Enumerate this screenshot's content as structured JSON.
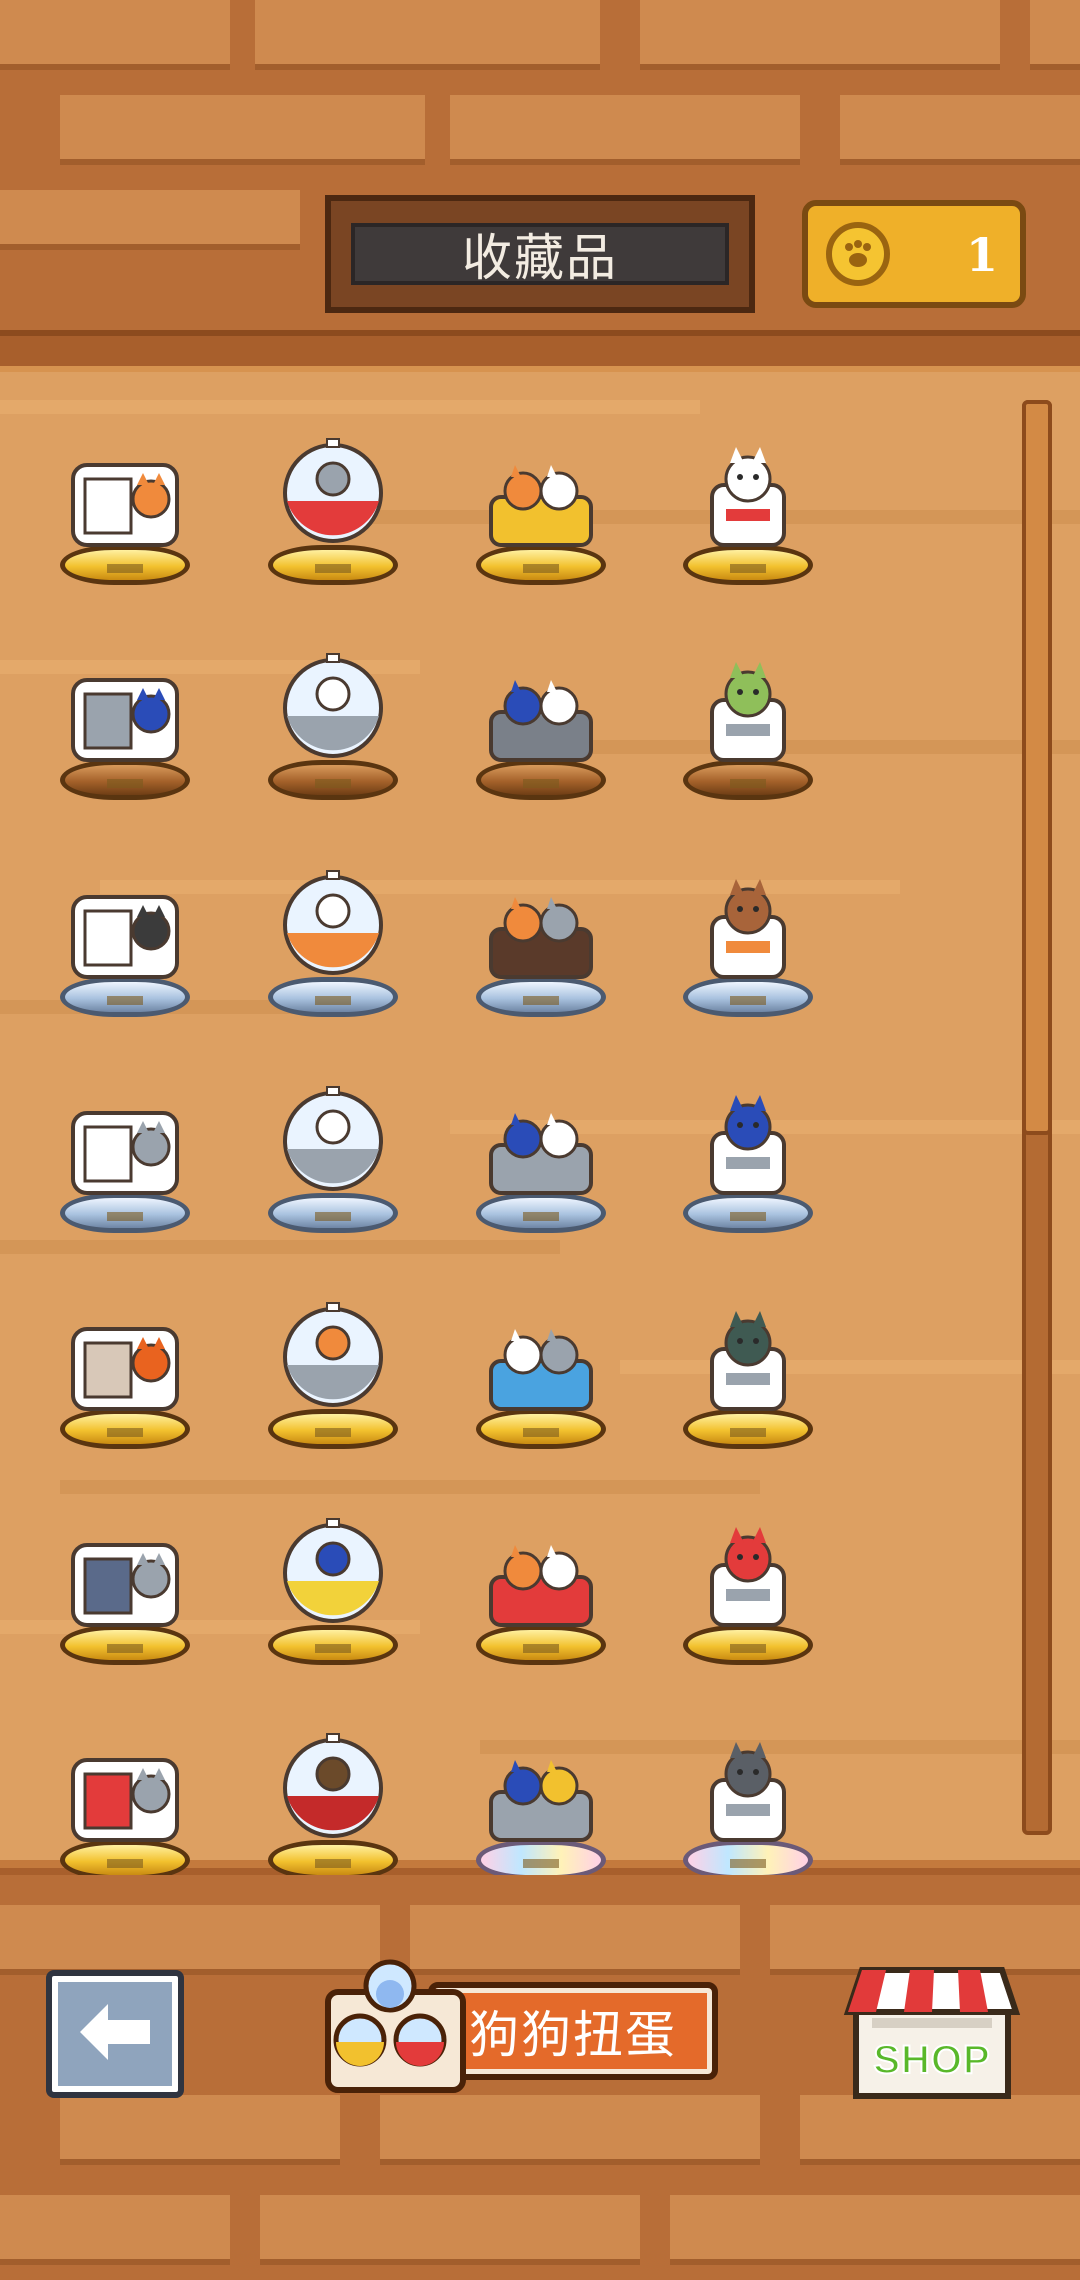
{
  "header": {
    "title": "收藏品",
    "coin_count": "1",
    "coin_icon": "paw-coin-icon"
  },
  "collectibles": [
    {
      "name": "collectible-1",
      "base": "gold"
    },
    {
      "name": "collectible-2",
      "base": "gold"
    },
    {
      "name": "collectible-3",
      "base": "gold"
    },
    {
      "name": "collectible-4",
      "base": "gold"
    },
    {
      "name": "collectible-5",
      "base": "bronze"
    },
    {
      "name": "collectible-6",
      "base": "bronze"
    },
    {
      "name": "collectible-7",
      "base": "bronze"
    },
    {
      "name": "collectible-8",
      "base": "bronze"
    },
    {
      "name": "collectible-9",
      "base": "silver"
    },
    {
      "name": "collectible-10",
      "base": "silver"
    },
    {
      "name": "collectible-11",
      "base": "silver"
    },
    {
      "name": "collectible-12",
      "base": "silver"
    },
    {
      "name": "collectible-13",
      "base": "silver"
    },
    {
      "name": "collectible-14",
      "base": "silver"
    },
    {
      "name": "collectible-15",
      "base": "silver"
    },
    {
      "name": "collectible-16",
      "base": "silver"
    },
    {
      "name": "collectible-17",
      "base": "gold"
    },
    {
      "name": "collectible-18",
      "base": "gold"
    },
    {
      "name": "collectible-19",
      "base": "gold"
    },
    {
      "name": "collectible-20",
      "base": "gold"
    },
    {
      "name": "collectible-21",
      "base": "gold"
    },
    {
      "name": "collectible-22",
      "base": "gold"
    },
    {
      "name": "collectible-23",
      "base": "gold"
    },
    {
      "name": "collectible-24",
      "base": "gold"
    },
    {
      "name": "collectible-25",
      "base": "gold"
    },
    {
      "name": "collectible-26",
      "base": "gold"
    },
    {
      "name": "collectible-27",
      "base": "rainbow"
    },
    {
      "name": "collectible-28",
      "base": "rainbow"
    }
  ],
  "footer": {
    "back_icon": "arrow-left-icon",
    "gacha_label": "狗狗扭蛋",
    "shop_label": "SHOP"
  }
}
